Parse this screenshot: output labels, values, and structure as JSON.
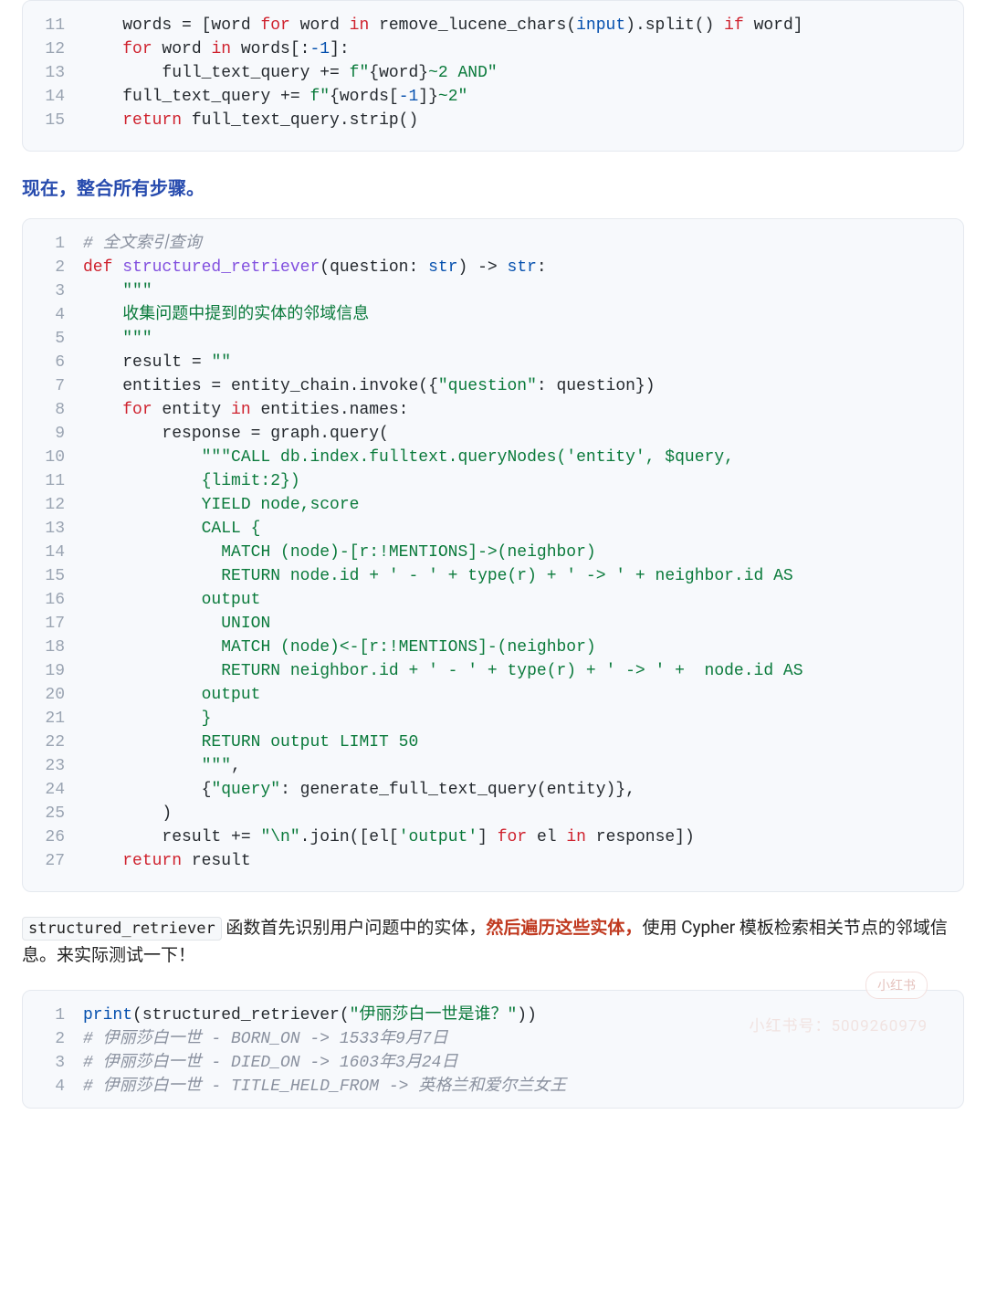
{
  "block1": {
    "start": 11,
    "lines": [
      {
        "i": "    ",
        "tokens": [
          {
            "t": "words = [word ",
            "c": ""
          },
          {
            "t": "for",
            "c": "tok-kw"
          },
          {
            "t": " word ",
            "c": ""
          },
          {
            "t": "in",
            "c": "tok-kw"
          },
          {
            "t": " remove_lucene_chars(",
            "c": ""
          },
          {
            "t": "input",
            "c": "tok-builtin"
          },
          {
            "t": ").split() ",
            "c": ""
          },
          {
            "t": "if",
            "c": "tok-kw"
          },
          {
            "t": " word]",
            "c": ""
          }
        ]
      },
      {
        "i": "    ",
        "tokens": [
          {
            "t": "for",
            "c": "tok-kw"
          },
          {
            "t": " word ",
            "c": ""
          },
          {
            "t": "in",
            "c": "tok-kw"
          },
          {
            "t": " words[:",
            "c": ""
          },
          {
            "t": "-1",
            "c": "tok-num"
          },
          {
            "t": "]:",
            "c": ""
          }
        ]
      },
      {
        "i": "        ",
        "tokens": [
          {
            "t": "full_text_query += ",
            "c": ""
          },
          {
            "t": "f\"",
            "c": "tok-str"
          },
          {
            "t": "{word}",
            "c": "tok-fstring-interp"
          },
          {
            "t": "~2 AND\"",
            "c": "tok-str"
          }
        ]
      },
      {
        "i": "    ",
        "tokens": [
          {
            "t": "full_text_query += ",
            "c": ""
          },
          {
            "t": "f\"",
            "c": "tok-str"
          },
          {
            "t": "{words[",
            "c": "tok-fstring-interp"
          },
          {
            "t": "-1",
            "c": "tok-num"
          },
          {
            "t": "]}",
            "c": "tok-fstring-interp"
          },
          {
            "t": "~2\"",
            "c": "tok-str"
          }
        ]
      },
      {
        "i": "    ",
        "tokens": [
          {
            "t": "return",
            "c": "tok-kw"
          },
          {
            "t": " full_text_query.strip()",
            "c": ""
          }
        ]
      }
    ]
  },
  "heading": "现在，整合所有步骤。",
  "block2": {
    "start": 1,
    "lines": [
      {
        "i": "",
        "tokens": [
          {
            "t": "# 全文索引查询",
            "c": "tok-comment"
          }
        ]
      },
      {
        "i": "",
        "tokens": [
          {
            "t": "def",
            "c": "tok-def"
          },
          {
            "t": " ",
            "c": ""
          },
          {
            "t": "structured_retriever",
            "c": "tok-fn"
          },
          {
            "t": "(question: ",
            "c": ""
          },
          {
            "t": "str",
            "c": "tok-builtin"
          },
          {
            "t": ") -> ",
            "c": ""
          },
          {
            "t": "str",
            "c": "tok-builtin"
          },
          {
            "t": ":",
            "c": ""
          }
        ]
      },
      {
        "i": "    ",
        "tokens": [
          {
            "t": "\"\"\"",
            "c": "tok-str-doc"
          }
        ]
      },
      {
        "i": "    ",
        "tokens": [
          {
            "t": "收集问题中提到的实体的邻域信息",
            "c": "tok-str-doc"
          }
        ]
      },
      {
        "i": "    ",
        "tokens": [
          {
            "t": "\"\"\"",
            "c": "tok-str-doc"
          }
        ]
      },
      {
        "i": "    ",
        "tokens": [
          {
            "t": "result = ",
            "c": ""
          },
          {
            "t": "\"\"",
            "c": "tok-str"
          }
        ]
      },
      {
        "i": "    ",
        "tokens": [
          {
            "t": "entities = entity_chain.invoke({",
            "c": ""
          },
          {
            "t": "\"question\"",
            "c": "tok-str"
          },
          {
            "t": ": question})",
            "c": ""
          }
        ]
      },
      {
        "i": "    ",
        "tokens": [
          {
            "t": "for",
            "c": "tok-kw"
          },
          {
            "t": " entity ",
            "c": ""
          },
          {
            "t": "in",
            "c": "tok-kw"
          },
          {
            "t": " entities.names:",
            "c": ""
          }
        ]
      },
      {
        "i": "        ",
        "tokens": [
          {
            "t": "response = graph.query(",
            "c": ""
          }
        ]
      },
      {
        "i": "            ",
        "tokens": [
          {
            "t": "\"\"\"CALL db.index.fulltext.queryNodes('entity', $query, ",
            "c": "tok-str"
          }
        ]
      },
      {
        "i": "            ",
        "tokens": [
          {
            "t": "{limit:2})",
            "c": "tok-str"
          }
        ]
      },
      {
        "i": "            ",
        "tokens": [
          {
            "t": "YIELD node,score",
            "c": "tok-str"
          }
        ]
      },
      {
        "i": "            ",
        "tokens": [
          {
            "t": "CALL {",
            "c": "tok-str"
          }
        ]
      },
      {
        "i": "              ",
        "tokens": [
          {
            "t": "MATCH (node)-[r:!MENTIONS]->(neighbor)",
            "c": "tok-str"
          }
        ]
      },
      {
        "i": "              ",
        "tokens": [
          {
            "t": "RETURN node.id + ' - ' + type(r) + ' -> ' + neighbor.id AS ",
            "c": "tok-str"
          }
        ]
      },
      {
        "i": "            ",
        "tokens": [
          {
            "t": "output",
            "c": "tok-str"
          }
        ]
      },
      {
        "i": "              ",
        "tokens": [
          {
            "t": "UNION",
            "c": "tok-str"
          }
        ]
      },
      {
        "i": "              ",
        "tokens": [
          {
            "t": "MATCH (node)<-[r:!MENTIONS]-(neighbor)",
            "c": "tok-str"
          }
        ]
      },
      {
        "i": "              ",
        "tokens": [
          {
            "t": "RETURN neighbor.id + ' - ' + type(r) + ' -> ' +  node.id AS ",
            "c": "tok-str"
          }
        ]
      },
      {
        "i": "            ",
        "tokens": [
          {
            "t": "output",
            "c": "tok-str"
          }
        ]
      },
      {
        "i": "            ",
        "tokens": [
          {
            "t": "}",
            "c": "tok-str"
          }
        ]
      },
      {
        "i": "            ",
        "tokens": [
          {
            "t": "RETURN output LIMIT 50",
            "c": "tok-str"
          }
        ]
      },
      {
        "i": "            ",
        "tokens": [
          {
            "t": "\"\"\"",
            "c": "tok-str"
          },
          {
            "t": ",",
            "c": ""
          }
        ]
      },
      {
        "i": "            ",
        "tokens": [
          {
            "t": "{",
            "c": ""
          },
          {
            "t": "\"query\"",
            "c": "tok-str"
          },
          {
            "t": ": generate_full_text_query(entity)},",
            "c": ""
          }
        ]
      },
      {
        "i": "        ",
        "tokens": [
          {
            "t": ")",
            "c": ""
          }
        ]
      },
      {
        "i": "        ",
        "tokens": [
          {
            "t": "result += ",
            "c": ""
          },
          {
            "t": "\"\\n\"",
            "c": "tok-str"
          },
          {
            "t": ".join([el[",
            "c": ""
          },
          {
            "t": "'output'",
            "c": "tok-str"
          },
          {
            "t": "] ",
            "c": ""
          },
          {
            "t": "for",
            "c": "tok-kw"
          },
          {
            "t": " el ",
            "c": ""
          },
          {
            "t": "in",
            "c": "tok-kw"
          },
          {
            "t": " response])",
            "c": ""
          }
        ]
      },
      {
        "i": "    ",
        "tokens": [
          {
            "t": "return",
            "c": "tok-kw"
          },
          {
            "t": " result",
            "c": ""
          }
        ]
      }
    ]
  },
  "paragraph": {
    "pieces": [
      {
        "type": "code",
        "text": "structured_retriever"
      },
      {
        "type": "text",
        "text": " 函数首先识别用户问题中的实体，"
      },
      {
        "type": "emph",
        "text": "然后遍历这些实体，"
      },
      {
        "type": "text",
        "text": "使用 Cypher 模板检索相关节点的邻域信息。来实际测试一下！"
      }
    ]
  },
  "block3": {
    "start": 1,
    "lines": [
      {
        "i": "",
        "tokens": [
          {
            "t": "print",
            "c": "tok-builtin"
          },
          {
            "t": "(structured_retriever(",
            "c": ""
          },
          {
            "t": "\"伊丽莎白一世是谁？\"",
            "c": "tok-str"
          },
          {
            "t": "))",
            "c": ""
          }
        ]
      },
      {
        "i": "",
        "tokens": [
          {
            "t": "# 伊丽莎白一世 - BORN_ON -> 1533年9月7日",
            "c": "tok-comment"
          }
        ]
      },
      {
        "i": "",
        "tokens": [
          {
            "t": "# 伊丽莎白一世 - DIED_ON -> 1603年3月24日",
            "c": "tok-comment"
          }
        ]
      },
      {
        "i": "",
        "tokens": [
          {
            "t": "# 伊丽莎白一世 - TITLE_HELD_FROM -> 英格兰和爱尔兰女王",
            "c": "tok-comment"
          }
        ]
      }
    ]
  },
  "watermark": {
    "badge": "小红书",
    "id": "小红书号：5009260979"
  }
}
